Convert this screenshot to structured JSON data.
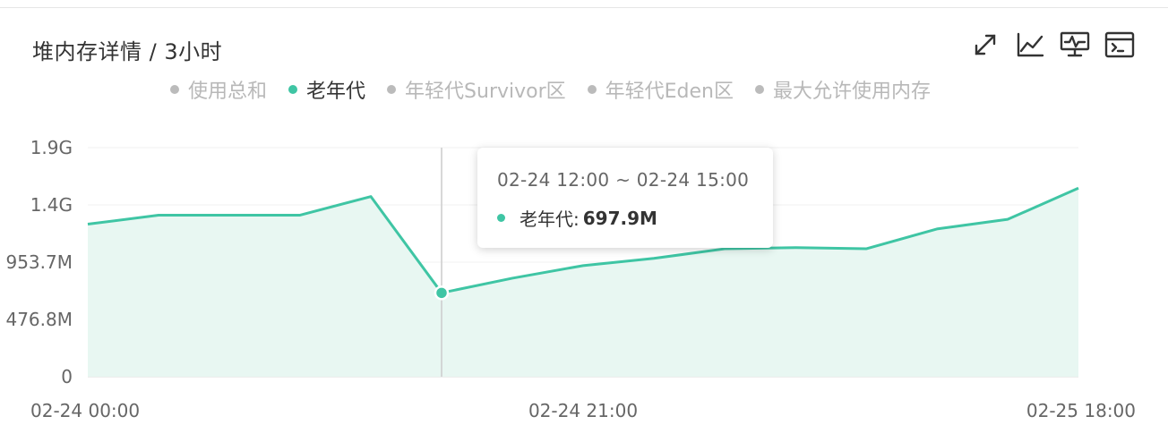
{
  "header": {
    "title": "堆内存详情 / 3小时"
  },
  "toolbar": [
    {
      "name": "fullscreen-icon"
    },
    {
      "name": "line-chart-icon"
    },
    {
      "name": "monitor-icon"
    },
    {
      "name": "terminal-icon"
    }
  ],
  "colors": {
    "active_series": "#3fc5a4",
    "inactive_legend": "#bbbbbb",
    "area_fill": "#e8f7f2"
  },
  "chart_data": {
    "type": "area",
    "legend": [
      {
        "label": "使用总和",
        "active": false
      },
      {
        "label": "老年代",
        "active": true
      },
      {
        "label": "年轻代Survivor区",
        "active": false
      },
      {
        "label": "年轻代Eden区",
        "active": false
      },
      {
        "label": "最大允许使用内存",
        "active": false
      }
    ],
    "y_ticks": [
      "0",
      "476.8M",
      "953.7M",
      "1.4G",
      "1.9G"
    ],
    "y_tick_values_mb": [
      0,
      476.8,
      953.7,
      1430.5,
      1907.3
    ],
    "ylim_mb": [
      0,
      1907.3
    ],
    "x_tick_labels": [
      {
        "label": "02-24 00:00",
        "index": 0
      },
      {
        "label": "02-24 21:00",
        "index": 7
      },
      {
        "label": "02-25 18:00",
        "index": 14
      }
    ],
    "x_start": "02-24 00:00",
    "x_step_hours": 3,
    "grid": "horizontal",
    "series": [
      {
        "name": "老年代",
        "values_mb": [
          1270,
          1345,
          1345,
          1345,
          1500,
          698,
          820,
          925,
          985,
          1065,
          1075,
          1065,
          1230,
          1310,
          1570
        ]
      }
    ],
    "highlight_index": 5
  },
  "tooltip": {
    "time": "02-24 12:00 ~ 02-24 15:00",
    "series_label": "老年代:",
    "value": "697.9M"
  }
}
